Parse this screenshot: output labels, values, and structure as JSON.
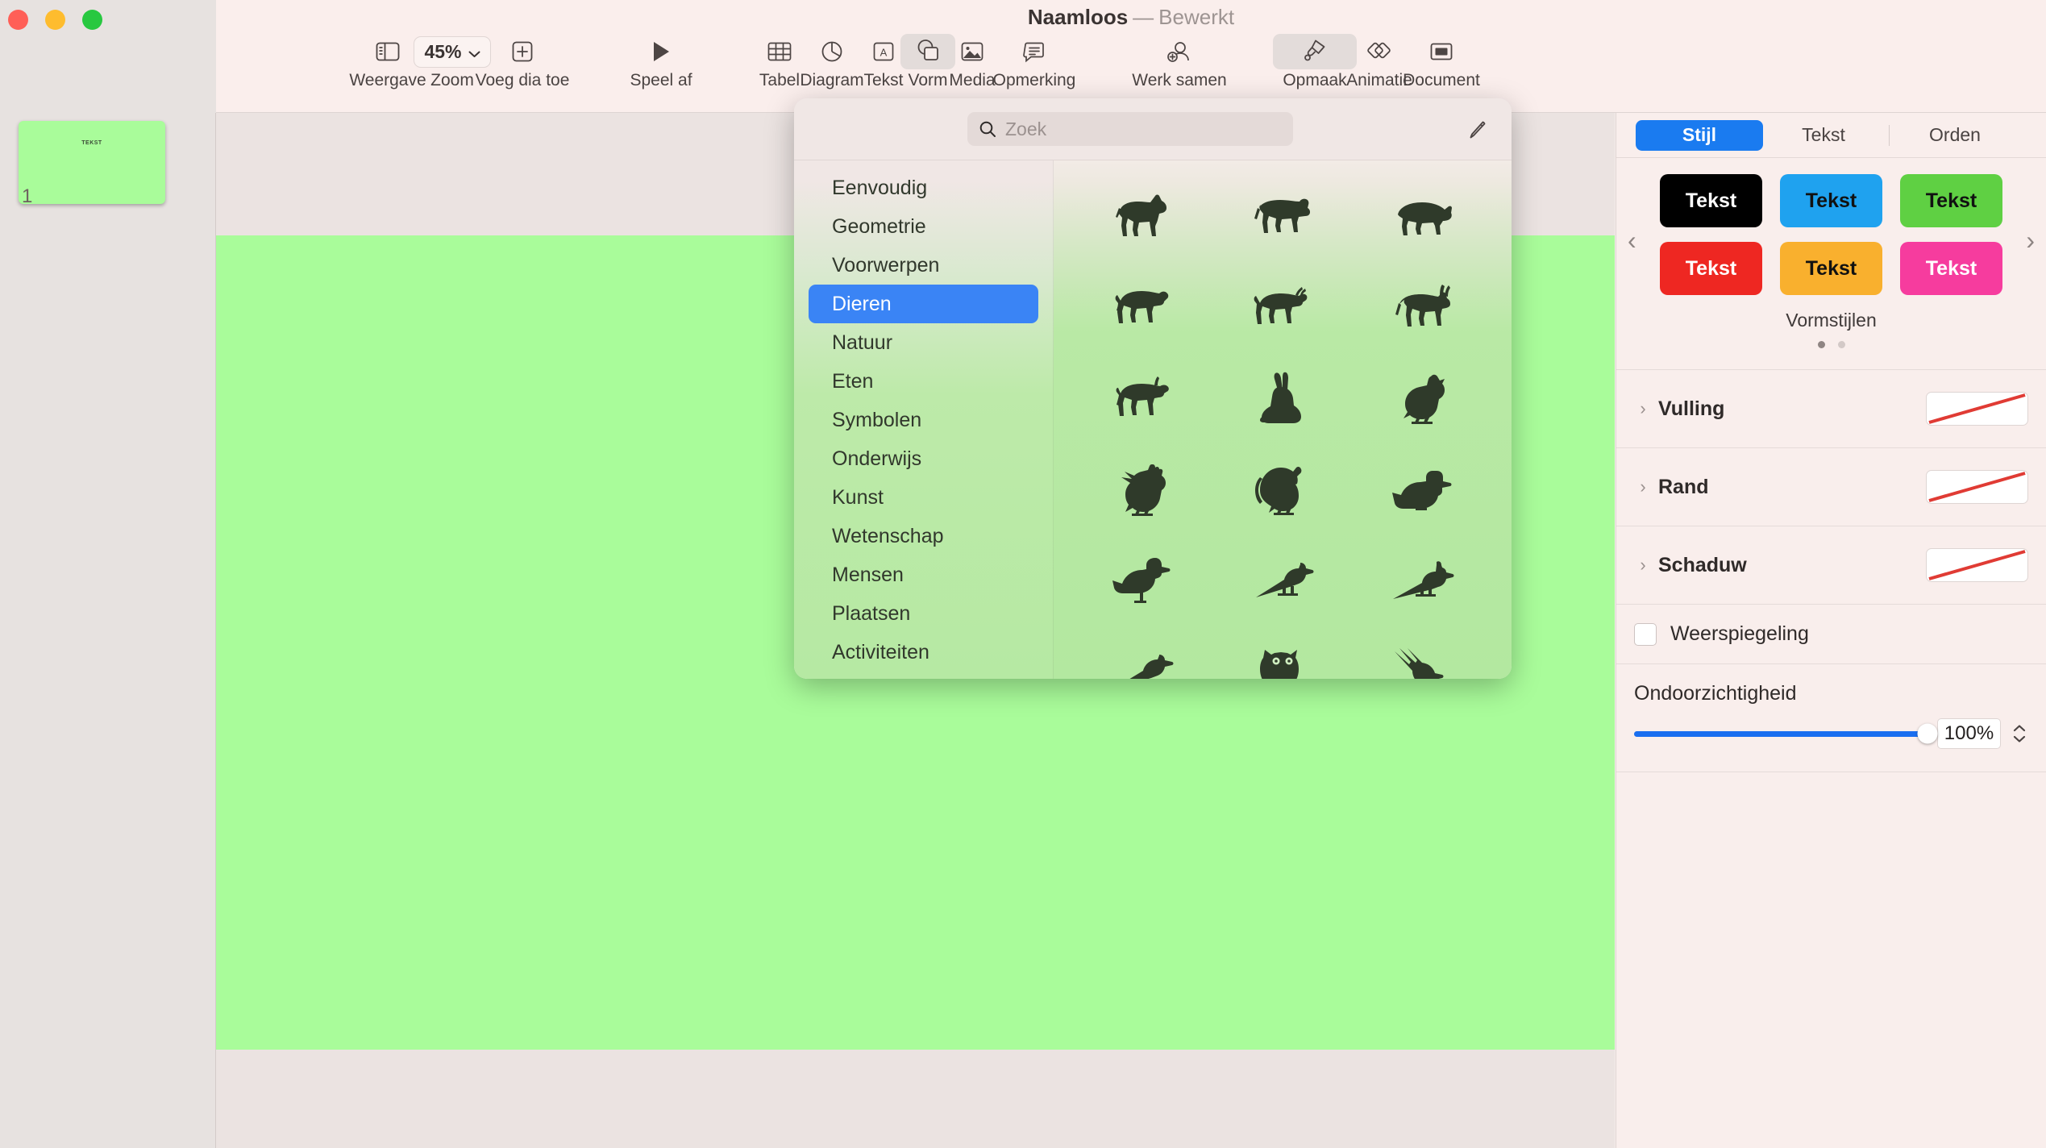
{
  "window": {
    "title_name": "Naamloos",
    "title_dash": "—",
    "title_state": "Bewerkt"
  },
  "toolbar": {
    "items": [
      {
        "label": "Weergave",
        "icon": "sidebar-icon",
        "active": false
      },
      {
        "label": "Zoom",
        "icon": "zoom-chevron-icon",
        "value": "45%",
        "active": false
      },
      {
        "label": "Voeg dia toe",
        "icon": "add-slide-icon",
        "active": false
      },
      {
        "label": "Speel af",
        "icon": "play-icon",
        "active": false
      },
      {
        "label": "Tabel",
        "icon": "table-icon",
        "active": false
      },
      {
        "label": "Diagram",
        "icon": "chart-icon",
        "active": false
      },
      {
        "label": "Tekst",
        "icon": "text-box-icon",
        "active": false
      },
      {
        "label": "Vorm",
        "icon": "shape-icon",
        "active": true
      },
      {
        "label": "Media",
        "icon": "media-image-icon",
        "active": false
      },
      {
        "label": "Opmerking",
        "icon": "comment-icon",
        "active": false
      },
      {
        "label": "Werk samen",
        "icon": "collaborate-icon",
        "active": false
      },
      {
        "label": "Opmaak",
        "icon": "paintbrush-icon",
        "active": true
      },
      {
        "label": "Animatie",
        "icon": "animate-icon",
        "active": false
      },
      {
        "label": "Document",
        "icon": "document-icon",
        "active": false
      }
    ]
  },
  "navigator": {
    "slide_number": "1",
    "thumb_text": "TEKST"
  },
  "popover": {
    "search": {
      "placeholder": "Zoek",
      "value": "",
      "icon": "search-icon"
    },
    "draw_icon": "pen-draw-icon",
    "categories": [
      {
        "label": "Eenvoudig",
        "selected": false
      },
      {
        "label": "Geometrie",
        "selected": false
      },
      {
        "label": "Voorwerpen",
        "selected": false
      },
      {
        "label": "Dieren",
        "selected": true
      },
      {
        "label": "Natuur",
        "selected": false
      },
      {
        "label": "Eten",
        "selected": false
      },
      {
        "label": "Symbolen",
        "selected": false
      },
      {
        "label": "Onderwijs",
        "selected": false
      },
      {
        "label": "Kunst",
        "selected": false
      },
      {
        "label": "Wetenschap",
        "selected": false
      },
      {
        "label": "Mensen",
        "selected": false
      },
      {
        "label": "Plaatsen",
        "selected": false
      },
      {
        "label": "Activiteiten",
        "selected": false
      }
    ],
    "shapes": [
      "horse-shape",
      "cow-shape",
      "pig-shape",
      "sheep-shape",
      "goat-shape",
      "donkey-shape",
      "bull-shape",
      "rabbit-shape",
      "hen-shape",
      "rooster-shape",
      "turkey-shape",
      "duck-shape",
      "goose-shape",
      "magpie-shape",
      "bluejay-shape",
      "crow-shape",
      "owl-shape",
      "eagle-shape"
    ],
    "shape_color": "#2f3a2a"
  },
  "inspector": {
    "tabs": [
      {
        "label": "Stijl",
        "active": true
      },
      {
        "label": "Tekst",
        "active": false
      },
      {
        "label": "Orden",
        "active": false
      }
    ],
    "shape_styles": {
      "caption": "Vormstijlen",
      "swatch_text": "Tekst",
      "swatches": [
        {
          "bg": "#000000",
          "fg": "#ffffff"
        },
        {
          "bg": "#1fa2ef",
          "fg": "#111111"
        },
        {
          "bg": "#5fd043",
          "fg": "#111111"
        },
        {
          "bg": "#ee2722",
          "fg": "#ffffff"
        },
        {
          "bg": "#f9b02e",
          "fg": "#111111"
        },
        {
          "bg": "#f63c9e",
          "fg": "#ffffff"
        }
      ],
      "prev_arrow": "‹",
      "next_arrow": "›",
      "page_dots": 2,
      "page_active": 0
    },
    "property_rows": [
      {
        "label": "Vulling",
        "disclosure": "›",
        "value_icon": "none-swatch"
      },
      {
        "label": "Rand",
        "disclosure": "›",
        "value_icon": "none-swatch"
      },
      {
        "label": "Schaduw",
        "disclosure": "›",
        "value_icon": "none-swatch"
      }
    ],
    "reflection": {
      "label": "Weerspiegeling",
      "checked": false
    },
    "opacity": {
      "label": "Ondoorzichtigheid",
      "value": "100%",
      "percent": 100
    },
    "accent_color": "#1a7bf0",
    "none_stroke_color": "#e03b34"
  }
}
